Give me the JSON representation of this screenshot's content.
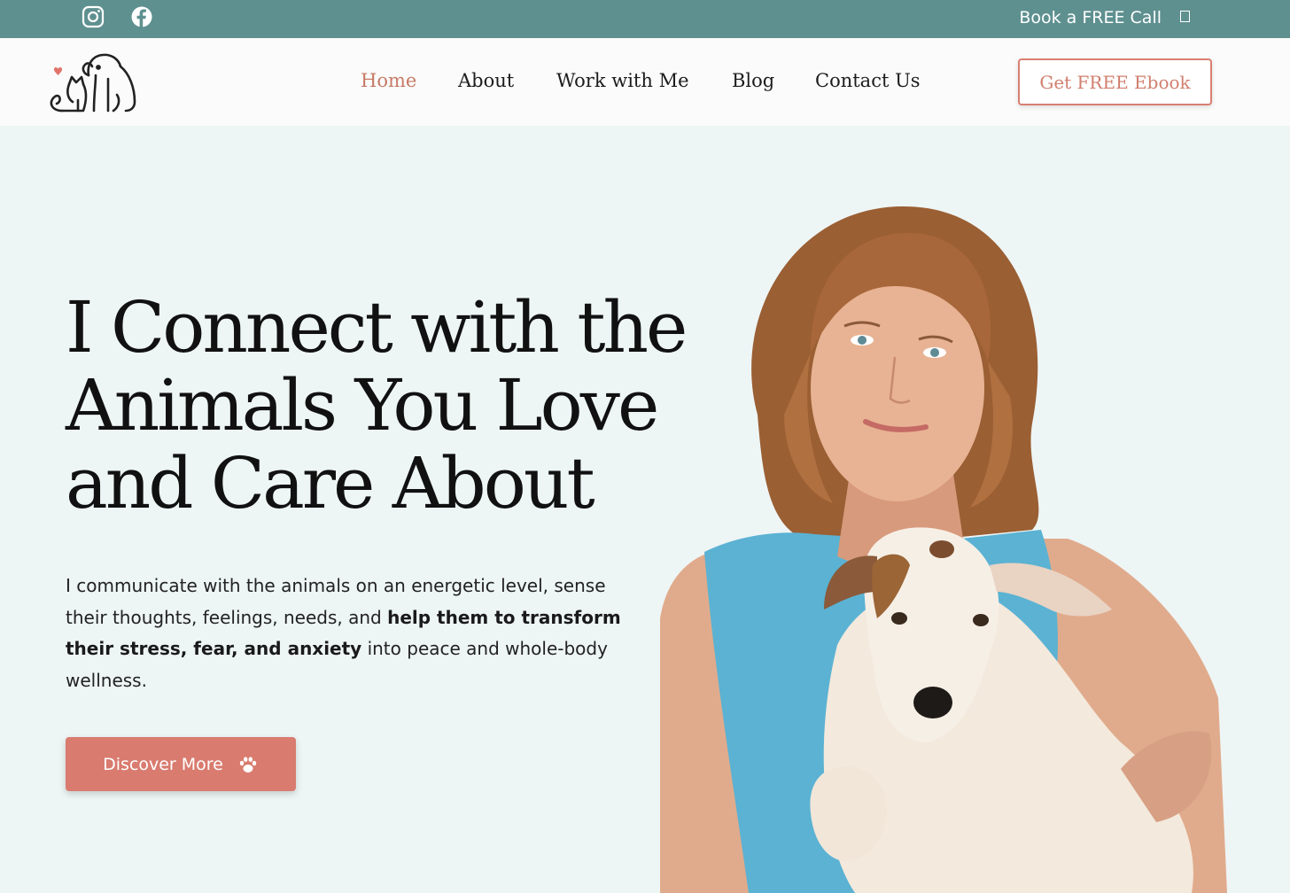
{
  "topbar": {
    "social": [
      {
        "icon": "instagram-icon",
        "label": "Instagram"
      },
      {
        "icon": "facebook-icon",
        "label": "Facebook"
      }
    ],
    "cta_label": "Book a FREE Call"
  },
  "header": {
    "logo_icon": "dog-cat-heart-logo",
    "nav": [
      {
        "label": "Home",
        "active": true
      },
      {
        "label": "About",
        "active": false
      },
      {
        "label": "Work with Me",
        "active": false
      },
      {
        "label": "Blog",
        "active": false
      },
      {
        "label": "Contact Us",
        "active": false
      }
    ],
    "ebook_button": "Get FREE Ebook"
  },
  "hero": {
    "title_lines": [
      "I Connect with the",
      "Animals You Love",
      "and Care About"
    ],
    "text_parts": [
      "I communicate with the animals on an energetic level, sense their thoughts, feelings, needs, and ",
      "help them to transform their stress, fear, and anxiety",
      " into peace and whole-body wellness."
    ],
    "button_label": "Discover More",
    "button_icon": "paw-icon",
    "photo_icon": "woman-holding-dog-photo"
  },
  "colors": {
    "topbar": "#5f9090",
    "accent": "#d97b6f",
    "active_nav": "#c77a66",
    "hero_bg": "#eef5f5"
  }
}
